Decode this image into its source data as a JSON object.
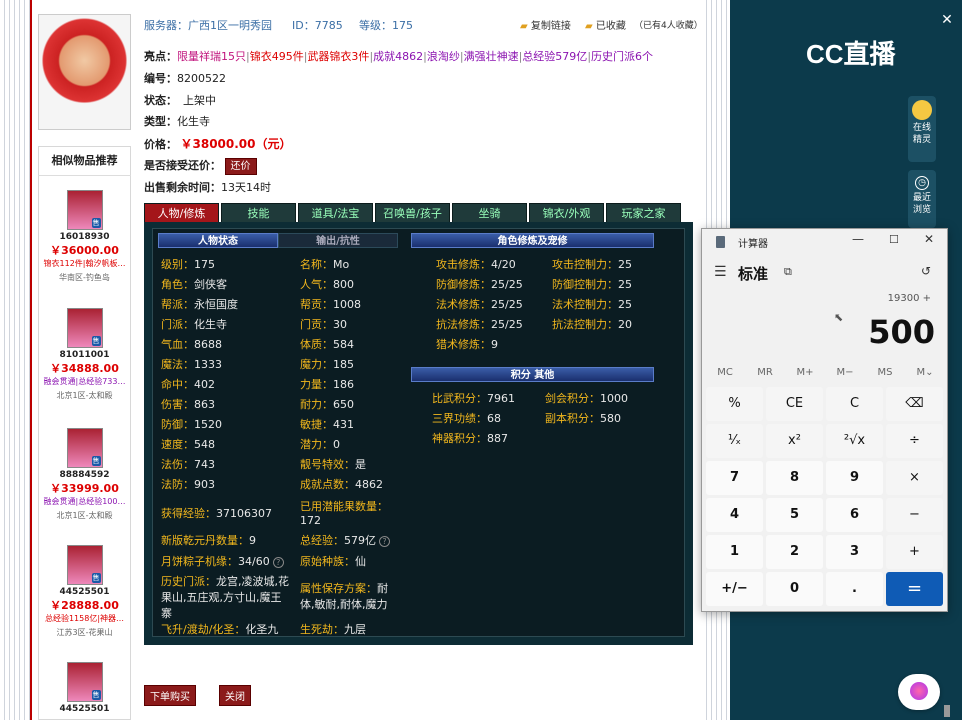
{
  "header": {
    "server_label": "服务器：",
    "server": "广西1区一明秀园",
    "id_label": "ID：",
    "id": "7785",
    "level_label": "等级：",
    "level": "175",
    "copy_link": "复制链接",
    "favorited": "已收藏",
    "fav_count": "（已有4人收藏）"
  },
  "highlights": {
    "label": "亮点：",
    "items": [
      "限量祥瑞15只",
      "锦衣495件",
      "武器锦衣3件",
      "成就4862",
      "浪淘纱",
      "满强壮神速",
      "总经验579亿",
      "历史门派6个"
    ]
  },
  "details": {
    "number_label": "编号：",
    "number": "8200522",
    "status_label": "状态：",
    "status": "上架中",
    "type_label": "类型：",
    "type": "化生寺",
    "price_label": "价格：",
    "price": "￥38000.00（元）",
    "bargain_label": "是否接受还价：",
    "bargain_btn": "还价",
    "remain_label": "出售剩余时间：",
    "remain": "13天14时"
  },
  "sidebar": {
    "title": "相似物品推荐",
    "items": [
      {
        "id": "16018930",
        "price": "￥36000.00",
        "desc": "锦衣112件|翰汐帆板…",
        "server": "华南区-钓鱼岛"
      },
      {
        "id": "81011001",
        "price": "￥34888.00",
        "desc": "融会贯通|总经验733…",
        "server": "北京1区-太和殿"
      },
      {
        "id": "88884592",
        "price": "￥33999.00",
        "desc": "融会贯通|总经验100…",
        "server": "北京1区-太和殿"
      },
      {
        "id": "44525501",
        "price": "￥28888.00",
        "desc": "总经验1158亿|神器…",
        "server": "江苏3区-花果山"
      },
      {
        "id": "44525501",
        "price": "",
        "desc": "",
        "server": ""
      }
    ],
    "badge": "售"
  },
  "tabs": [
    "人物/修炼",
    "技能",
    "道具/法宝",
    "召唤兽/孩子",
    "坐骑",
    "锦衣/外观",
    "玩家之家"
  ],
  "panel": {
    "left_heads": [
      "人物状态",
      "输出/抗性"
    ],
    "right_head": "角色修炼及宠修",
    "score_head": "积分 其他",
    "col1": [
      [
        "级别：",
        "175"
      ],
      [
        "角色：",
        "剑侠客"
      ],
      [
        "帮派：",
        "永恒国度"
      ],
      [
        "门派：",
        "化生寺"
      ],
      [
        "气血：",
        "8688"
      ],
      [
        "魔法：",
        "1333"
      ],
      [
        "命中：",
        "402"
      ],
      [
        "伤害：",
        "863"
      ],
      [
        "防御：",
        "1520"
      ],
      [
        "速度：",
        "548"
      ],
      [
        "法伤：",
        "743"
      ],
      [
        "法防：",
        "903"
      ]
    ],
    "col2": [
      [
        "名称：",
        "Mo"
      ],
      [
        "人气：",
        "800"
      ],
      [
        "帮贡：",
        "1008"
      ],
      [
        "门贡：",
        "30"
      ],
      [
        "体质：",
        "584"
      ],
      [
        "魔力：",
        "185"
      ],
      [
        "力量：",
        "186"
      ],
      [
        "耐力：",
        "650"
      ],
      [
        "敏捷：",
        "431"
      ],
      [
        "潜力：",
        "0"
      ],
      [
        "靓号特效：",
        "是"
      ],
      [
        "成就点数：",
        "4862"
      ]
    ],
    "exp_label": "获得经验：",
    "exp": "37106307",
    "potential_label": "已用潜能果数量：",
    "potential": "172",
    "yuandan_label": "新版乾元丹数量：",
    "yuandan": "9",
    "totalexp_label": "总经验：",
    "totalexp": "579亿",
    "moon_label": "月饼粽子机缘：",
    "moon": "34/60",
    "race_label": "原始种族：",
    "race": "仙",
    "history_label": "历史门派：",
    "history": "龙宫,凌波城,花果山,五庄观,方寸山,魔王寨",
    "attr_label": "属性保存方案：",
    "attr": "耐体,敏耐,耐体,魔力",
    "feisheng_label": "飞升/渡劫/化圣：",
    "feisheng": "化圣九",
    "life_label": "生死劫：",
    "life": "九层",
    "xiulian": [
      [
        "攻击修炼：",
        "4/20",
        "攻击控制力：",
        "25"
      ],
      [
        "防御修炼：",
        "25/25",
        "防御控制力：",
        "25"
      ],
      [
        "法术修炼：",
        "25/25",
        "法术控制力：",
        "25"
      ],
      [
        "抗法修炼：",
        "25/25",
        "抗法控制力：",
        "20"
      ],
      [
        "猎术修炼：",
        "9",
        "",
        ""
      ]
    ],
    "scores": [
      [
        "比武积分：",
        "7961",
        "剑会积分：",
        "1000"
      ],
      [
        "三界功绩：",
        "68",
        "副本积分：",
        "580"
      ],
      [
        "神器积分：",
        "887",
        "",
        ""
      ]
    ]
  },
  "buttons": {
    "buy": "下单购买",
    "close": "关闭"
  },
  "cc": {
    "logo": "CC直播",
    "online": "在线精灵",
    "recent": "最近浏览"
  },
  "calculator": {
    "title": "计算器",
    "mode": "标准",
    "expression": "19300 +",
    "display": "500",
    "memory": [
      "MC",
      "MR",
      "M+",
      "M−",
      "MS",
      "M⌄"
    ],
    "keys": [
      [
        "%",
        "CE",
        "C",
        "⌫"
      ],
      [
        "¹⁄ₓ",
        "x²",
        "²√x",
        "÷"
      ],
      [
        "7",
        "8",
        "9",
        "×"
      ],
      [
        "4",
        "5",
        "6",
        "−"
      ],
      [
        "1",
        "2",
        "3",
        "+"
      ],
      [
        "+/−",
        "0",
        ".",
        "="
      ]
    ]
  }
}
